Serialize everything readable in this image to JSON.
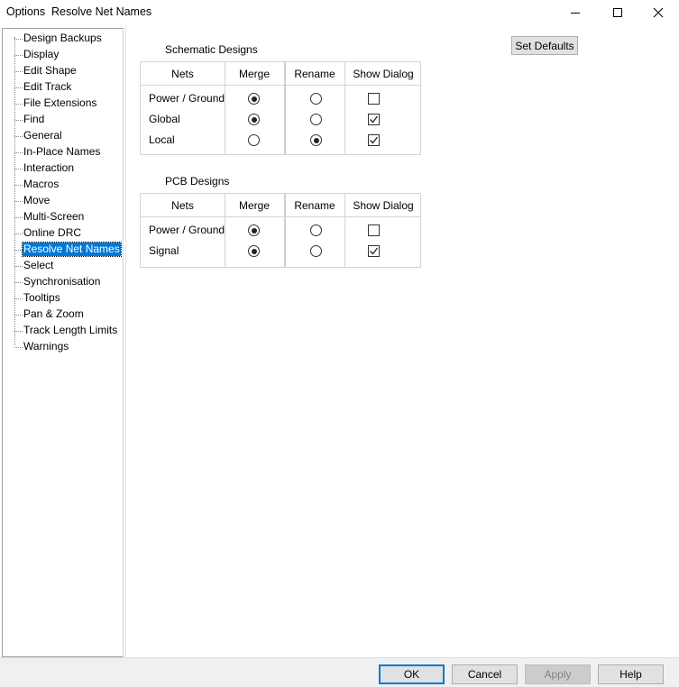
{
  "window": {
    "title": "Options  Resolve Net Names"
  },
  "tree": {
    "items": [
      {
        "label": "Design Backups"
      },
      {
        "label": "Display"
      },
      {
        "label": "Edit Shape"
      },
      {
        "label": "Edit Track"
      },
      {
        "label": "File Extensions"
      },
      {
        "label": "Find"
      },
      {
        "label": "General"
      },
      {
        "label": "In-Place Names"
      },
      {
        "label": "Interaction"
      },
      {
        "label": "Macros"
      },
      {
        "label": "Move"
      },
      {
        "label": "Multi-Screen"
      },
      {
        "label": "Online DRC"
      },
      {
        "label": "Resolve Net Names",
        "selected": true
      },
      {
        "label": "Select"
      },
      {
        "label": "Synchronisation"
      },
      {
        "label": "Tooltips"
      },
      {
        "label": "Pan & Zoom"
      },
      {
        "label": "Track Length Limits"
      },
      {
        "label": "Warnings"
      }
    ]
  },
  "set_defaults_label": "Set Defaults",
  "schematic": {
    "title": "Schematic Designs",
    "headers": {
      "nets": "Nets",
      "merge": "Merge",
      "rename": "Rename",
      "show_dialog": "Show Dialog"
    },
    "rows": [
      {
        "name": "Power / Ground",
        "choice": "merge",
        "show_dialog": false
      },
      {
        "name": "Global",
        "choice": "merge",
        "show_dialog": true
      },
      {
        "name": "Local",
        "choice": "rename",
        "show_dialog": true
      }
    ]
  },
  "pcb": {
    "title": "PCB Designs",
    "headers": {
      "nets": "Nets",
      "merge": "Merge",
      "rename": "Rename",
      "show_dialog": "Show Dialog"
    },
    "rows": [
      {
        "name": "Power / Ground",
        "choice": "merge",
        "show_dialog": false
      },
      {
        "name": "Signal",
        "choice": "merge",
        "show_dialog": true
      }
    ]
  },
  "footer": {
    "ok": "OK",
    "cancel": "Cancel",
    "apply": "Apply",
    "help": "Help"
  }
}
